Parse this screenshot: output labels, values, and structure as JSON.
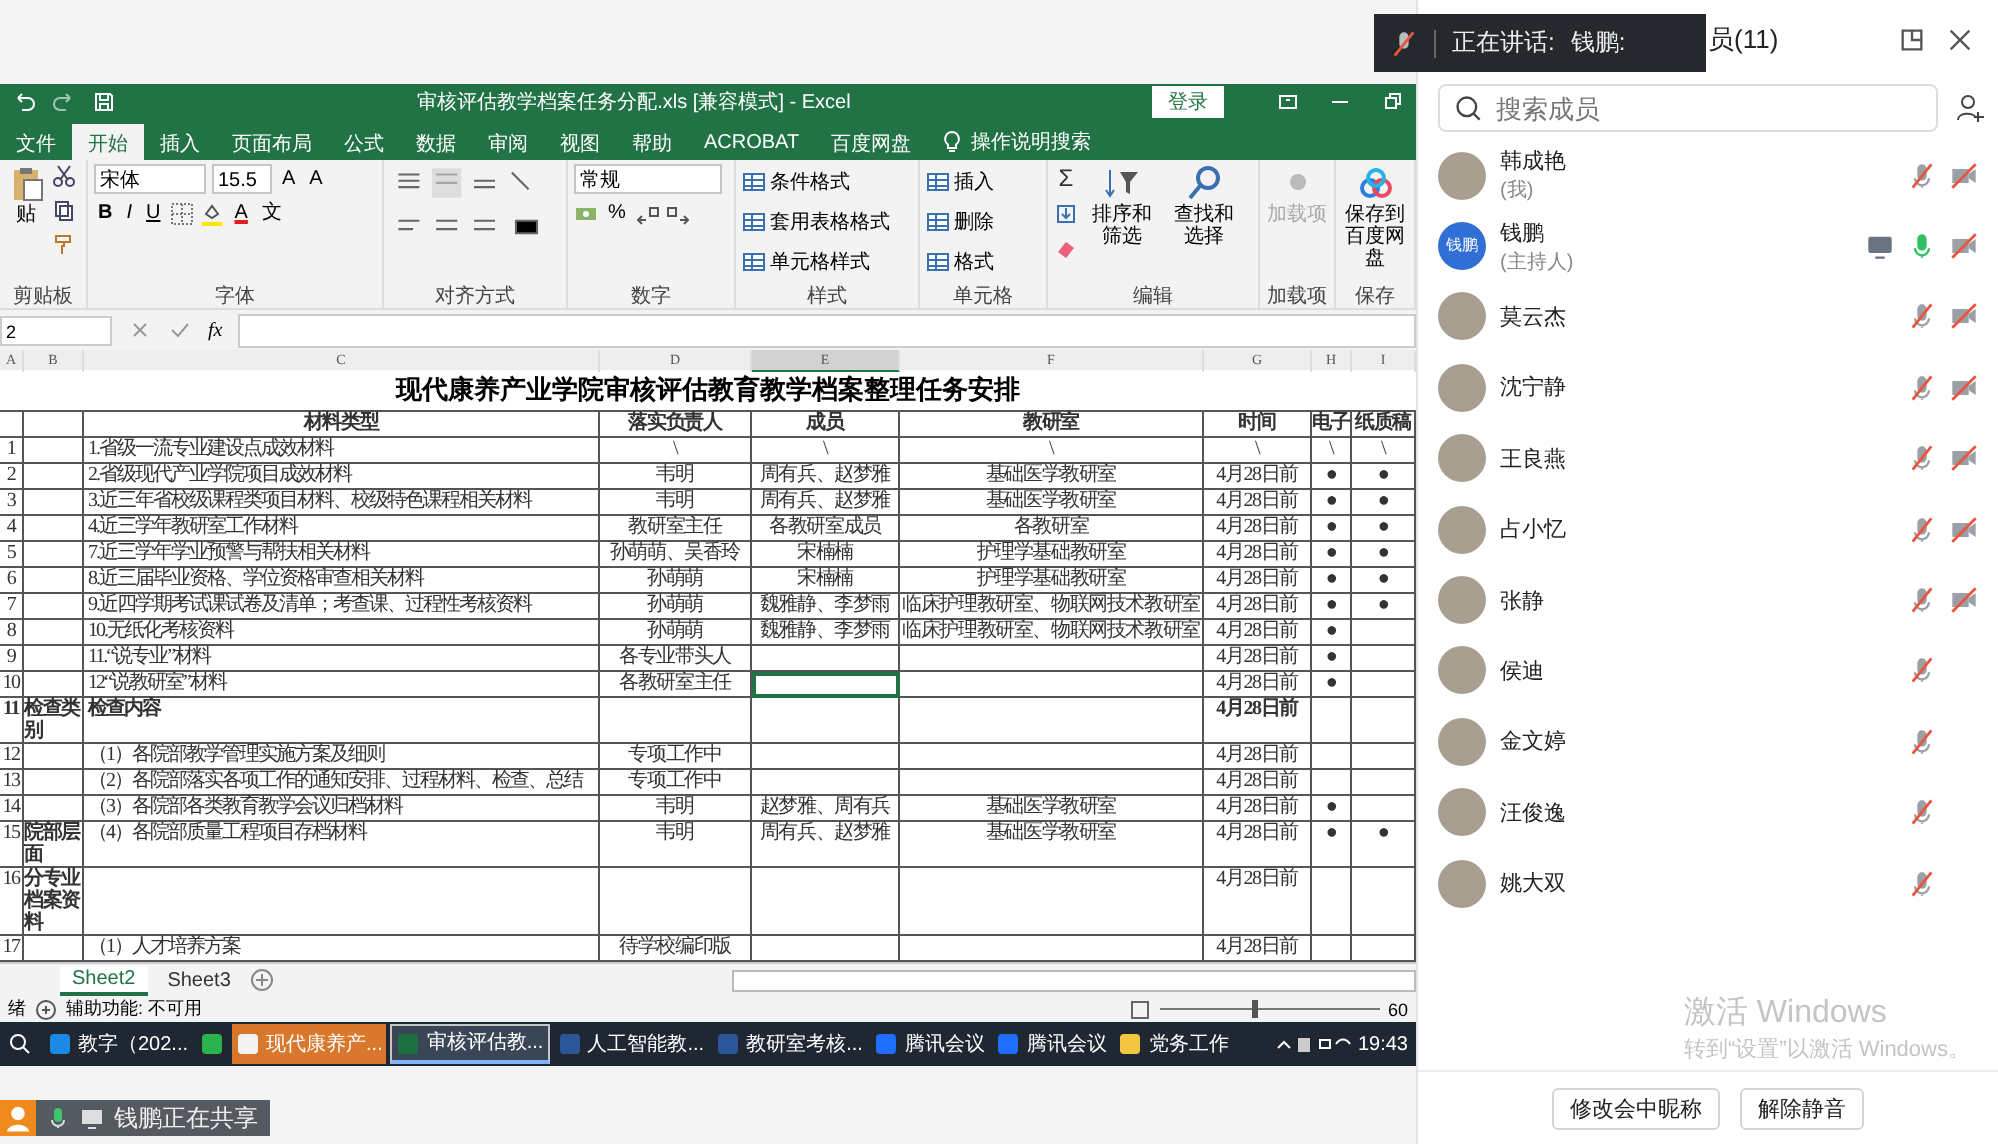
{
  "speaking_bar": {
    "label": "正在讲话:",
    "speaker": "钱鹏:"
  },
  "excel": {
    "title": "审核评估教学档案任务分配.xls  [兼容模式]  -  Excel",
    "login": "登录",
    "tabs": [
      {
        "label": "文件",
        "selected": false
      },
      {
        "label": "开始",
        "selected": true
      },
      {
        "label": "插入",
        "selected": false
      },
      {
        "label": "页面布局",
        "selected": false
      },
      {
        "label": "公式",
        "selected": false
      },
      {
        "label": "数据",
        "selected": false
      },
      {
        "label": "审阅",
        "selected": false
      },
      {
        "label": "视图",
        "selected": false
      },
      {
        "label": "帮助",
        "selected": false
      },
      {
        "label": "ACROBAT",
        "selected": false
      },
      {
        "label": "百度网盘",
        "selected": false
      }
    ],
    "tell_me": "操作说明搜索",
    "ribbon": [
      {
        "label": "剪贴板",
        "kind": "clipboard",
        "items": [
          "贴"
        ]
      },
      {
        "label": "字体",
        "kind": "font",
        "font": "宋体",
        "size": "15.5",
        "grow": [
          "A",
          "A"
        ],
        "styles": [
          "B",
          "I",
          "U"
        ],
        "color_letter": "A",
        "phonetic": "文"
      },
      {
        "label": "对齐方式",
        "kind": "align"
      },
      {
        "label": "数字",
        "kind": "number",
        "format": "常规",
        "symbols": [
          "%"
        ]
      },
      {
        "label": "样式",
        "kind": "list",
        "items": [
          "条件格式",
          "套用表格格式",
          "单元格样式"
        ]
      },
      {
        "label": "单元格",
        "kind": "list",
        "items": [
          "插入",
          "删除",
          "格式"
        ]
      },
      {
        "label": "编辑",
        "kind": "edit",
        "symbol": "Σ",
        "items": [
          "排序和筛选",
          "查找和选择"
        ]
      },
      {
        "label": "加载项",
        "kind": "big",
        "items": [
          "加载项"
        ],
        "disabled": true
      },
      {
        "label": "保存",
        "kind": "big",
        "items": [
          "保存到百度网盘"
        ],
        "disabled": false
      }
    ],
    "name_box": "2",
    "fx": "fx",
    "columns": [
      "A",
      "B",
      "C",
      "D",
      "E",
      "F",
      "G",
      "H",
      "I"
    ],
    "sheet_title": "现代康养产业学院审核评估教育教学档案整理任务安排",
    "headers": {
      "c": "材料类型",
      "d": "落实负责人",
      "e": "成员",
      "f": "教研室",
      "g": "时间",
      "h": "电子",
      "i": "纸质稿"
    },
    "rows": [
      {
        "a": "1",
        "c": "1.省级一流专业建设点成效材料",
        "d": "\\",
        "e": "\\",
        "f": "\\",
        "g": "\\",
        "h": "\\",
        "i": "\\",
        "bold": false,
        "selected": false
      },
      {
        "a": "2",
        "c": "2.省级现代产业学院项目成效材料",
        "d": "韦明",
        "e": "周有兵、赵梦雅",
        "f": "基础医学教研室",
        "g": "4月28日前",
        "h": "●",
        "i": "●",
        "bold": false,
        "selected": false
      },
      {
        "a": "3",
        "c": "3.近三年省校级课程类项目材料、校级特色课程相关材料",
        "d": "韦明",
        "e": "周有兵、赵梦雅",
        "f": "基础医学教研室",
        "g": "4月28日前",
        "h": "●",
        "i": "●",
        "bold": false,
        "selected": false
      },
      {
        "a": "4",
        "c": "4.近三学年教研室工作材料",
        "d": "教研室主任",
        "e": "各教研室成员",
        "f": "各教研室",
        "g": "4月28日前",
        "h": "●",
        "i": "●",
        "bold": false,
        "selected": false
      },
      {
        "a": "5",
        "c": "7.近三学年学业预警与帮扶相关材料",
        "d": "孙萌萌、吴香玲",
        "e": "宋楠楠",
        "f": "护理学基础教研室",
        "g": "4月28日前",
        "h": "●",
        "i": "●",
        "bold": false,
        "selected": false
      },
      {
        "a": "6",
        "c": "8.近三届毕业资格、学位资格审查相关材料",
        "d": "孙萌萌",
        "e": "宋楠楠",
        "f": "护理学基础教研室",
        "g": "4月28日前",
        "h": "●",
        "i": "●",
        "bold": false,
        "selected": false
      },
      {
        "a": "7",
        "c": "9.近四学期考试课试卷及清单；考查课、过程性考核资料",
        "d": "孙萌萌",
        "e": "魏雅静、李梦雨",
        "f": "临床护理教研室、物联网技术教研室",
        "g": "4月28日前",
        "h": "●",
        "i": "●",
        "bold": false,
        "selected": false
      },
      {
        "a": "8",
        "c": "10.无纸化考核资料",
        "d": "孙萌萌",
        "e": "魏雅静、李梦雨",
        "f": "临床护理教研室、物联网技术教研室",
        "g": "4月28日前",
        "h": "●",
        "bold": false,
        "selected": false
      },
      {
        "a": "9",
        "c": "11.“说专业”材料",
        "d": "各专业带头人",
        "g": "4月28日前",
        "h": "●",
        "bold": false,
        "selected": false
      },
      {
        "a": "10",
        "c": "12“说教研室”材料",
        "d": "各教研室主任",
        "g": "4月28日前",
        "h": "●",
        "bold": false,
        "selected": true
      },
      {
        "a": "11",
        "b": "检查类别",
        "c": "检查内容",
        "g": "4月28日前",
        "bold": true,
        "selected": false
      },
      {
        "a": "12",
        "c": "（1）各院部教学管理实施方案及细则",
        "d": "专项工作中",
        "g": "4月28日前",
        "bold": false,
        "selected": false
      },
      {
        "a": "13",
        "c": "（2）各院部落实各项工作的通知安排、过程材料、检查、总结",
        "d": "专项工作中",
        "g": "4月28日前",
        "bold": false,
        "selected": false
      },
      {
        "a": "14",
        "c": "（3）各院部各类教育教学会议归档材料",
        "d": "韦明",
        "e": "赵梦雅、周有兵",
        "f": "基础医学教研室",
        "g": "4月28日前",
        "h": "●",
        "bold": false,
        "selected": false
      },
      {
        "a": "15",
        "b": "院部层面",
        "c": "（4）各院部质量工程项目存档材料",
        "d": "韦明",
        "e": "周有兵、赵梦雅",
        "f": "基础医学教研室",
        "g": "4月28日前",
        "h": "●",
        "i": "●",
        "bold": false,
        "selected": false
      },
      {
        "a": "16",
        "b": "分专业档案资料",
        "g": "4月28日前",
        "bold": false,
        "selected": false
      },
      {
        "a": "17",
        "c": "（1）人才培养方案",
        "d": "待学校编印版",
        "g": "4月28日前",
        "bold": false,
        "selected": false
      }
    ],
    "sheet_tabs": [
      {
        "label": "Sheet2",
        "selected": true
      },
      {
        "label": "Sheet3",
        "selected": false
      }
    ],
    "status": "绪",
    "accessibility": "辅助功能: 不可用",
    "zoom_slider": {
      "level": 0.42
    },
    "zoom": "60"
  },
  "taskbar": {
    "items": [
      {
        "kind": "browser",
        "label": "教字（202...",
        "selected": false,
        "flashing": false
      },
      {
        "kind": "chat",
        "selected": false,
        "flashing": false
      },
      {
        "kind": "app",
        "label": "现代康养产...",
        "selected": false,
        "flashing": true
      },
      {
        "kind": "excel",
        "label": "审核评估教...",
        "selected": true,
        "flashing": false
      },
      {
        "kind": "word",
        "label": "人工智能教...",
        "selected": false,
        "flashing": false
      },
      {
        "kind": "word",
        "label": "教研室考核...",
        "selected": false,
        "flashing": false
      },
      {
        "kind": "meeting",
        "label": "腾讯会议",
        "selected": false,
        "flashing": false
      },
      {
        "kind": "meeting",
        "label": "腾讯会议",
        "selected": false,
        "flashing": false
      },
      {
        "kind": "folder",
        "label": "党务工作",
        "selected": false,
        "flashing": false
      }
    ],
    "time": "19:43"
  },
  "share_badge": {
    "text": "钱鹏正在共享"
  },
  "panel": {
    "title": "员(11)",
    "search": {
      "placeholder": "搜索成员"
    },
    "members": [
      {
        "name": "韩成艳",
        "role": "(我)",
        "muted": true,
        "camera_off": true,
        "sharing": false
      },
      {
        "name": "钱鹏",
        "role": "(主持人)",
        "avatar_text": "钱鹏",
        "muted": false,
        "camera_off": true,
        "sharing": true
      },
      {
        "name": "莫云杰",
        "muted": true,
        "camera_off": true,
        "sharing": false
      },
      {
        "name": "沈宁静",
        "muted": true,
        "camera_off": true,
        "sharing": false
      },
      {
        "name": "王良燕",
        "muted": true,
        "camera_off": true,
        "sharing": false
      },
      {
        "name": "占小忆",
        "muted": true,
        "camera_off": true,
        "sharing": false
      },
      {
        "name": "张静",
        "muted": true,
        "camera_off": true,
        "sharing": false
      },
      {
        "name": "侯迪",
        "muted": true,
        "camera_off": false,
        "sharing": false
      },
      {
        "name": "金文婷",
        "muted": true,
        "camera_off": false,
        "sharing": false
      },
      {
        "name": "汪俊逸",
        "muted": true,
        "camera_off": false,
        "sharing": false
      },
      {
        "name": "姚大双",
        "muted": true,
        "camera_off": false,
        "sharing": false
      }
    ],
    "buttons": [
      "修改会中昵称",
      "解除静音"
    ]
  },
  "windows_notice": {
    "title": "激活 Windows",
    "text": "转到“设置”以激活 Windows。"
  }
}
